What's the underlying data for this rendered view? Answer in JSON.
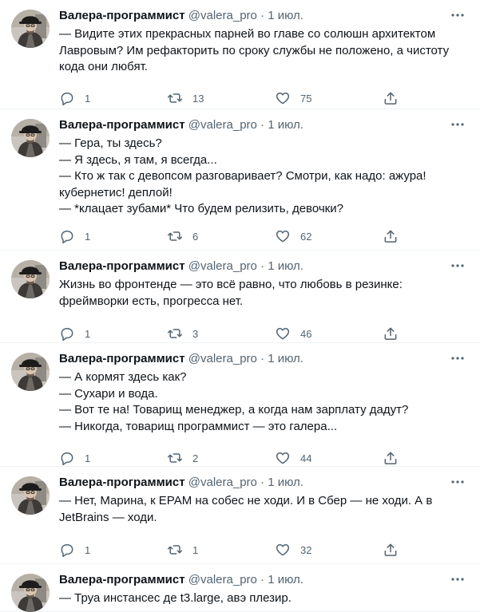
{
  "tweets": [
    {
      "name": "Валера-программист",
      "handle": "@valera_pro",
      "date": "1 июл.",
      "lines": [
        "— Видите этих прекрасных парней во главе со солюшн архитектом",
        "Лавровым? Им рефакторить по сроку службы не положено, а чистоту",
        "кода они любят."
      ],
      "replies": "1",
      "retweets": "13",
      "likes": "75"
    },
    {
      "name": "Валера-программист",
      "handle": "@valera_pro",
      "date": "1 июл.",
      "lines": [
        "— Гера, ты здесь?",
        "— Я здесь, я там, я всегда...",
        "— Кто ж так с девопсом разговаривает? Смотри, как надо: ажура!",
        "кубернетис! деплой!",
        "— *клацает зубами* Что будем релизить, девочки?"
      ],
      "replies": "1",
      "retweets": "6",
      "likes": "62"
    },
    {
      "name": "Валера-программист",
      "handle": "@valera_pro",
      "date": "1 июл.",
      "lines": [
        "Жизнь во фронтенде — это всё равно, что любовь в резинке:",
        "фреймворки есть, прогресса нет."
      ],
      "replies": "1",
      "retweets": "3",
      "likes": "46"
    },
    {
      "name": "Валера-программист",
      "handle": "@valera_pro",
      "date": "1 июл.",
      "lines": [
        "— А кормят здесь как?",
        "— Сухари и вода.",
        "— Вот те на! Товарищ менеджер, а когда нам зарплату дадут?",
        "— Никогда, товарищ программист — это галера..."
      ],
      "replies": "1",
      "retweets": "2",
      "likes": "44"
    },
    {
      "name": "Валера-программист",
      "handle": "@valera_pro",
      "date": "1 июл.",
      "lines": [
        "— Нет, Марина, к EPAM на собес не ходи. И в Сбер — не ходи. А в",
        "JetBrains — ходи."
      ],
      "replies": "1",
      "retweets": "1",
      "likes": "32"
    },
    {
      "name": "Валера-программист",
      "handle": "@valera_pro",
      "date": "1 июл.",
      "lines": [
        "— Труа инстансес де t3.large, авэ плезир."
      ],
      "replies": "",
      "retweets": "",
      "likes": ""
    }
  ],
  "icons": {
    "reply": "reply-icon",
    "retweet": "retweet-icon",
    "like": "heart-icon",
    "share": "share-icon",
    "more": "more-icon"
  },
  "colors": {
    "text": "#0f1419",
    "muted": "#536471",
    "divider": "#eff3f4"
  }
}
